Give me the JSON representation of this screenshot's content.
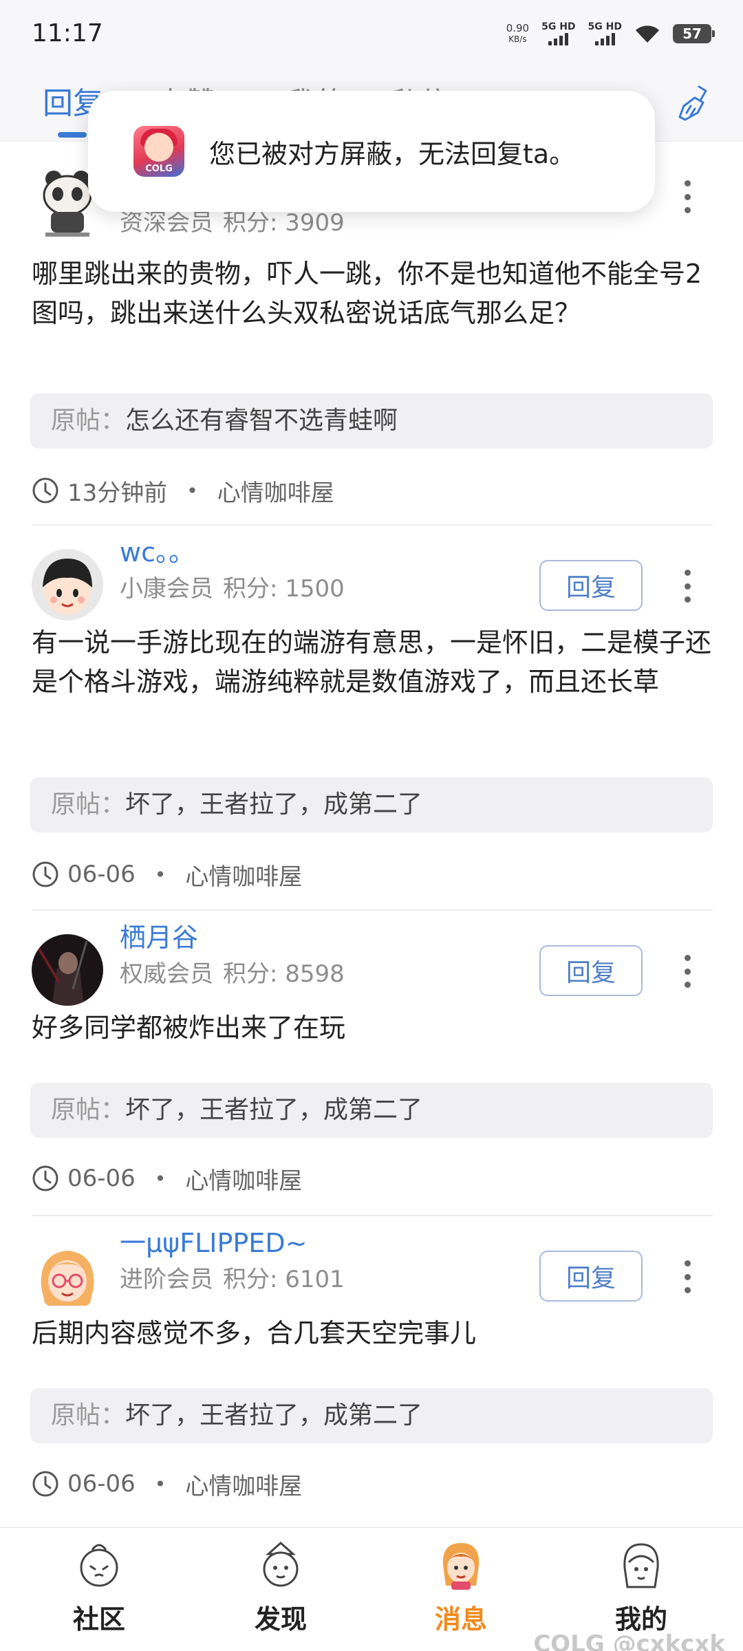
{
  "status_bar": {
    "time": "11:17",
    "net_speed_value": "0.90",
    "net_speed_unit": "KB/s",
    "sim1": "5G HD",
    "sim2": "5G HD",
    "battery": "57"
  },
  "tabs": [
    {
      "label": "回复",
      "active": true
    },
    {
      "label": "点赞"
    },
    {
      "label": "@我的"
    },
    {
      "label": "私信"
    }
  ],
  "toast": {
    "app_brand": "COLG",
    "message": "您已被对方屏蔽，无法回复ta。"
  },
  "reply_button_label": "回复",
  "points_label": "积分: ",
  "quote_label": "原帖：",
  "items": [
    {
      "username": "",
      "level": "资深会员",
      "points": "3909",
      "content": "哪里跳出来的贵物，吓人一跳，你不是也知道他不能全号2图吗，跳出来送什么头双私密说话底气那么足？",
      "quote": "怎么还有睿智不选青蛙啊",
      "time": "13分钟前",
      "forum": "心情咖啡屋",
      "avatar": "panda-avatar"
    },
    {
      "username": "wc。。",
      "level": "小康会员",
      "points": "1500",
      "content": "有一说一手游比现在的端游有意思，一是怀旧，二是模子还是个格斗游戏，端游纯粹就是数值游戏了，而且还长草",
      "quote": "坏了，王者拉了，成第二了",
      "time": "06-06",
      "forum": "心情咖啡屋",
      "avatar": "cartoon-boy-avatar"
    },
    {
      "username": "栖月谷",
      "level": "权威会员",
      "points": "8598",
      "content": "好多同学都被炸出来了在玩",
      "quote": "坏了，王者拉了，成第二了",
      "time": "06-06",
      "forum": "心情咖啡屋",
      "avatar": "dark-warrior-avatar"
    },
    {
      "username": "一μψFLIPPED~",
      "level": "进阶会员",
      "points": "6101",
      "content": "后期内容感觉不多，合几套天空完事儿",
      "quote": "坏了，王者拉了，成第二了",
      "time": "06-06",
      "forum": "心情咖啡屋",
      "avatar": "glasses-girl-avatar"
    }
  ],
  "bottom_nav": [
    {
      "label": "社区",
      "icon": "community-icon"
    },
    {
      "label": "发现",
      "icon": "discover-icon"
    },
    {
      "label": "消息",
      "icon": "message-icon",
      "active": true
    },
    {
      "label": "我的",
      "icon": "profile-icon"
    }
  ],
  "watermark": "COLG @cxkcxk",
  "colors": {
    "accent": "#3a7bd5",
    "nav_active": "#f08a1c",
    "quote_bg": "#f0f0f2"
  }
}
